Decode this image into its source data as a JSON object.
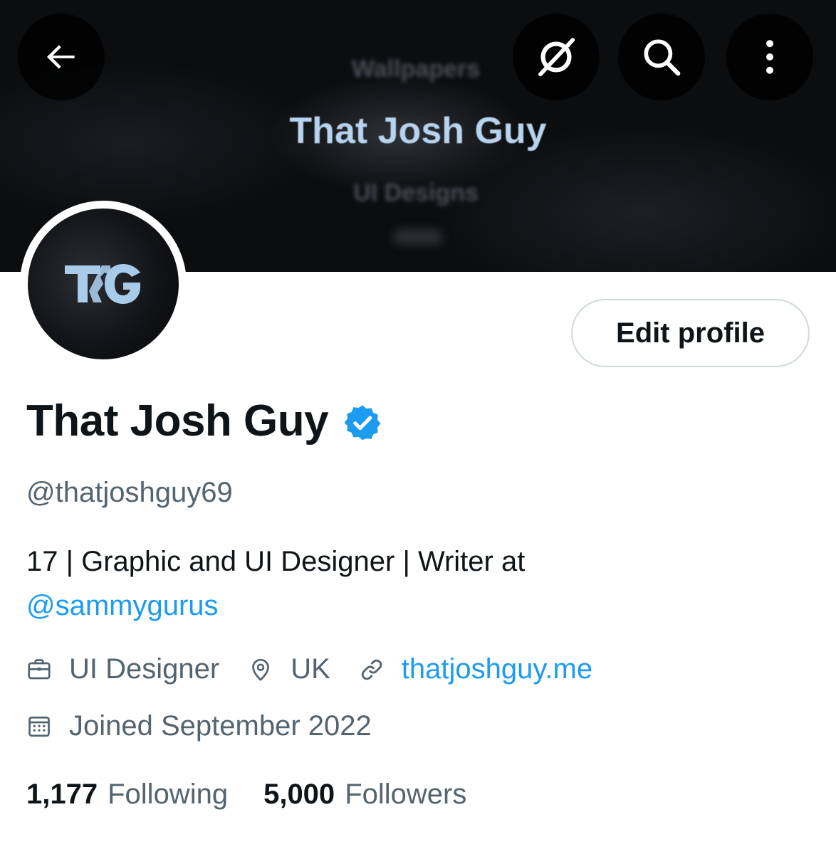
{
  "banner": {
    "line1": "Wallpapers",
    "title": "That Josh Guy",
    "line3": "UI Designs"
  },
  "topbar": {
    "back_icon": "arrow-left-icon",
    "noconn_icon": "no-connection-icon",
    "search_icon": "search-icon",
    "more_icon": "more-vertical-icon"
  },
  "avatar": {
    "monogram": "TG"
  },
  "actions": {
    "edit_profile_label": "Edit profile"
  },
  "profile": {
    "display_name": "That Josh Guy",
    "verified": true,
    "handle": "@thatjoshguy69",
    "bio_text": "17 | Graphic and UI Designer | Writer at",
    "bio_mention": "@sammygurus",
    "profession": "UI Designer",
    "location": "UK",
    "website": "thatjoshguy.me",
    "joined": "Joined September 2022"
  },
  "stats": {
    "following_count": "1,177",
    "following_label": "Following",
    "followers_count": "5,000",
    "followers_label": "Followers"
  },
  "colors": {
    "accent": "#1d9bf0",
    "text_primary": "#0f1419",
    "text_secondary": "#536471",
    "border": "#cfd9de"
  }
}
